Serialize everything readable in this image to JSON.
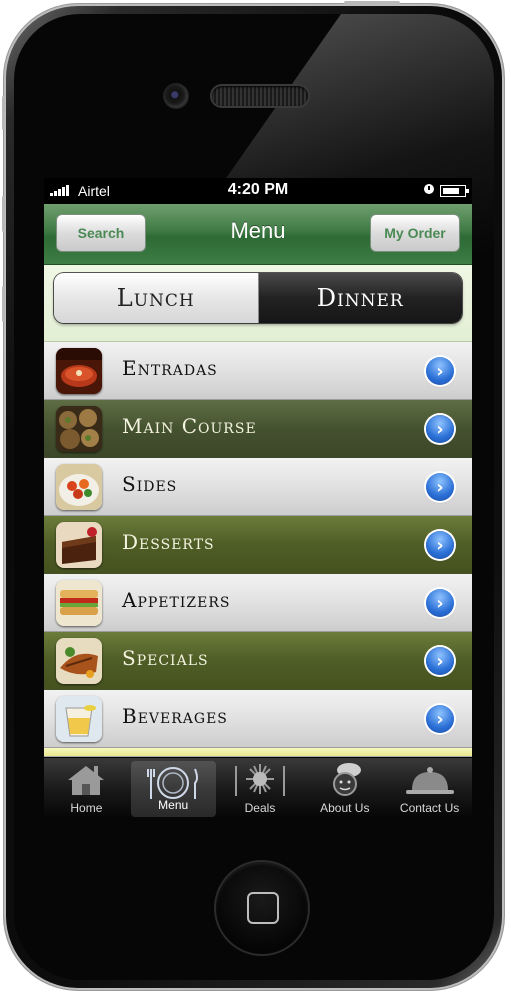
{
  "status_bar": {
    "carrier": "Airtel",
    "time": "4:20 PM"
  },
  "nav_bar": {
    "title": "Menu",
    "left_button": "Search",
    "right_button": "My Order"
  },
  "meal_toggle": {
    "options": [
      "Lunch",
      "Dinner"
    ],
    "selected": "Dinner"
  },
  "menu_items": [
    {
      "label": "Entradas",
      "icon": "soup-icon",
      "style": "light"
    },
    {
      "label": "Main Course",
      "icon": "stuffed-mushrooms-icon",
      "style": "dark"
    },
    {
      "label": "Sides",
      "icon": "salad-bowl-icon",
      "style": "light"
    },
    {
      "label": "Desserts",
      "icon": "chocolate-cake-icon",
      "style": "dark"
    },
    {
      "label": "Appetizers",
      "icon": "sandwich-icon",
      "style": "light"
    },
    {
      "label": "Specials",
      "icon": "grilled-meat-icon",
      "style": "dark"
    },
    {
      "label": "Beverages",
      "icon": "drink-glass-icon",
      "style": "light"
    }
  ],
  "tab_bar": {
    "tabs": [
      {
        "label": "Home",
        "icon": "home-icon"
      },
      {
        "label": "Menu",
        "icon": "plate-cutlery-icon"
      },
      {
        "label": "Deals",
        "icon": "starburst-icon"
      },
      {
        "label": "About Us",
        "icon": "chef-icon"
      },
      {
        "label": "Contact Us",
        "icon": "cloche-icon"
      }
    ],
    "active": "Menu"
  },
  "colors": {
    "nav_green": "#3f7a44",
    "dark_row": "#455230",
    "arrow_blue": "#2a6fd6"
  }
}
